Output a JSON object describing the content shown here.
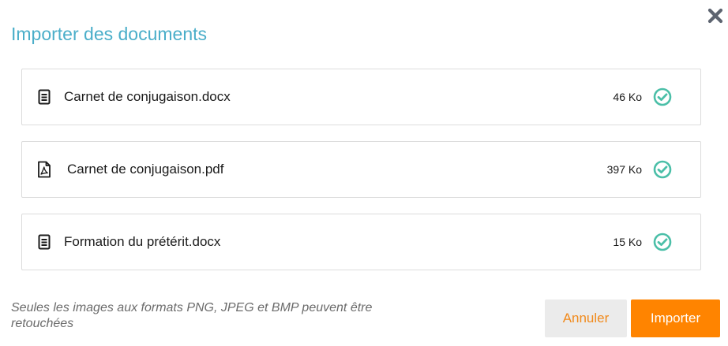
{
  "dialog": {
    "title": "Importer des documents",
    "close_icon": "close-icon"
  },
  "files": [
    {
      "name": "Carnet de conjugaison.docx",
      "size": "46 Ko",
      "type_icon": "document-icon",
      "status_icon": "check-circle-icon"
    },
    {
      "name": "Carnet de conjugaison.pdf",
      "size": "397 Ko",
      "type_icon": "pdf-icon",
      "status_icon": "check-circle-icon"
    },
    {
      "name": "Formation du prétérit.docx",
      "size": "15 Ko",
      "type_icon": "document-icon",
      "status_icon": "check-circle-icon"
    }
  ],
  "footer": {
    "note": "Seules les images aux formats PNG, JPEG et BMP peuvent être retouchées",
    "cancel_label": "Annuler",
    "import_label": "Importer"
  },
  "colors": {
    "title": "#4aaec9",
    "success": "#4bbfa8",
    "primary": "#ff8400",
    "cancel_text": "#f18a1c",
    "cancel_bg": "#ebebeb",
    "close_icon": "#5d6470"
  }
}
